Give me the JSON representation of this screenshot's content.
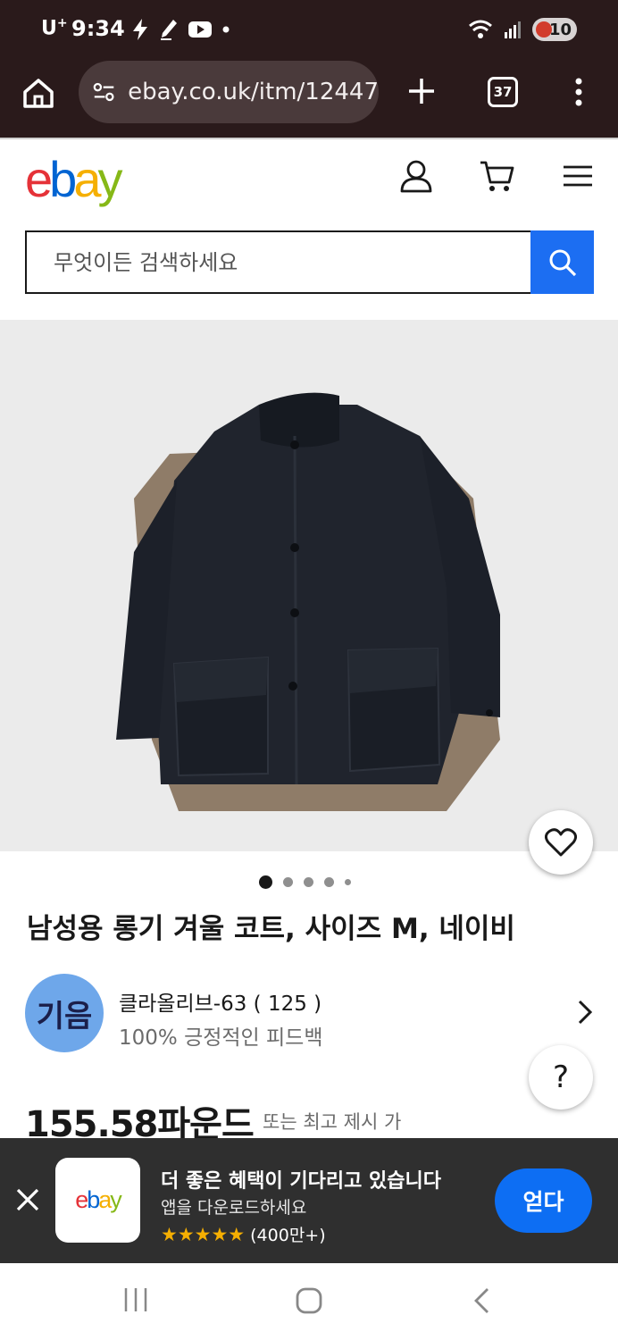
{
  "status_bar": {
    "carrier": "U",
    "carrier_sup": "+",
    "time": "9:34",
    "battery": "10"
  },
  "browser": {
    "url": "ebay.co.uk/itm/12447",
    "tab_count": "37"
  },
  "header": {
    "logo": [
      "e",
      "b",
      "a",
      "y"
    ]
  },
  "search": {
    "placeholder": "무엇이든 검색하세요"
  },
  "product": {
    "title": "남성용 롱기 겨울 코트, 사이즈 M, 네이비",
    "image_count": 5,
    "active_image_index": 0,
    "price": "155.58파운드",
    "price_note": "또는 최고 제시 가"
  },
  "seller": {
    "avatar_initials": "기음",
    "name": "클라올리브-63 ( 125 )",
    "feedback": "100% 긍정적인 피드백"
  },
  "help": {
    "label": "?"
  },
  "app_banner": {
    "icon_logo": [
      "e",
      "b",
      "a",
      "y"
    ],
    "title": "더 좋은 혜택이 기다리고 있습니다",
    "subtitle": "앱을 다운로드하세요",
    "stars": "★★★★★",
    "rating_count": "(400만+)",
    "get_label": "얻다"
  },
  "colors": {
    "browser_chrome": "#2a1a1b",
    "search_button": "#1c6ef2",
    "get_button": "#0d6ef3",
    "banner_bg": "#2f2f2f",
    "star": "#f5af02"
  }
}
